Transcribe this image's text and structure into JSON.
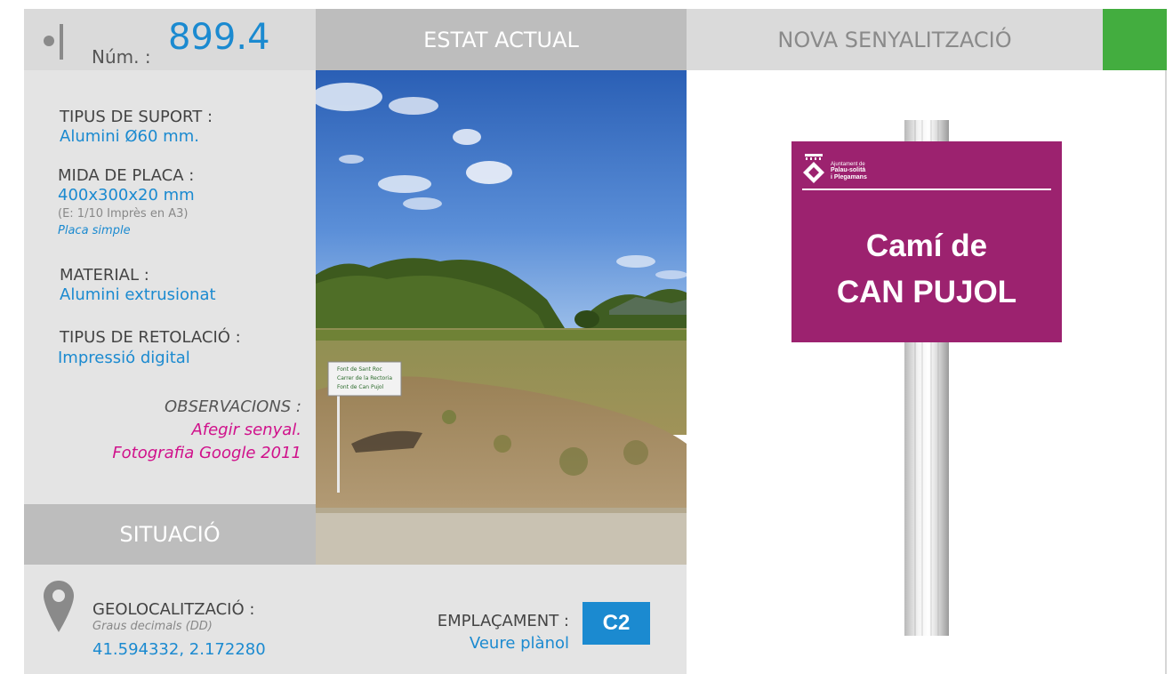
{
  "header": {
    "num_label": "Núm. :",
    "num_value": "899.4",
    "estat_actual": "ESTAT ACTUAL",
    "nova_senyalitzacio": "NOVA SENYALITZACIÓ"
  },
  "info": {
    "suport_label": "TIPUS DE SUPORT :",
    "suport_value": "Alumini Ø60 mm.",
    "mida_label": "MIDA DE PLACA :",
    "mida_value": "400x300x20 mm",
    "mida_scale": "(E: 1/10 Imprès en A3)",
    "mida_type": "Placa simple",
    "material_label": "MATERIAL :",
    "material_value": "Alumini extrusionat",
    "retolacio_label": "TIPUS DE RETOLACIÓ :",
    "retolacio_value": "Impressió digital",
    "observacions_label": "OBSERVACIONS :",
    "observacions_line1": "Afegir senyal.",
    "observacions_line2": "Fotografia Google 2011"
  },
  "situacio": {
    "title": "SITUACIÓ"
  },
  "photo_sign": {
    "line1": "Font de Sant Roc",
    "line2": "Carrer de la Rectoria",
    "line3": "Font de Can Pujol"
  },
  "location": {
    "geo_label": "GEOLOCALITZACIÓ :",
    "geo_format": "Graus decimals (DD)",
    "geo_coords": "41.594332, 2.172280",
    "emplacament_label": "EMPLAÇAMENT :",
    "emplacament_link": "Veure plànol",
    "emplacament_code": "C2"
  },
  "new_sign": {
    "logo_line1": "Ajuntament de",
    "logo_line2": "Palau-solità",
    "logo_line3": "i Plegamans",
    "text_line1": "Camí de",
    "text_line2": "CAN PUJOL"
  },
  "colors": {
    "accent_blue": "#1b8ad0",
    "magenta": "#d0118b",
    "sign_purple": "#9c226f",
    "green_tab": "#43ad3f"
  }
}
